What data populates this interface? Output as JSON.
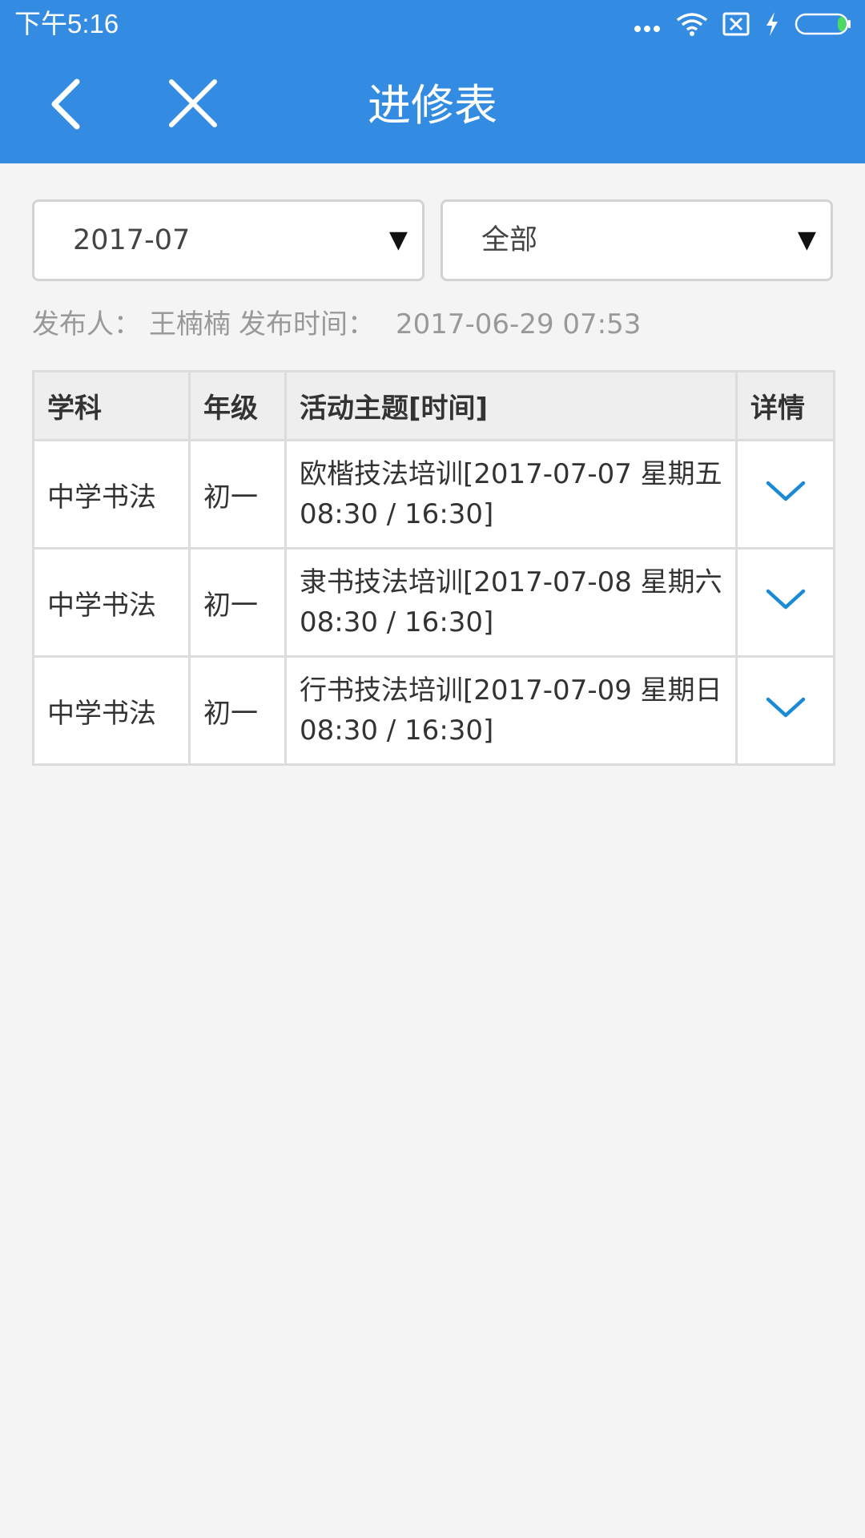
{
  "status_bar": {
    "time": "下午5:16",
    "icons": [
      "more-dots-icon",
      "wifi-icon",
      "sim-error-icon",
      "charging-icon",
      "battery-icon"
    ]
  },
  "header": {
    "title": "进修表",
    "back_icon": "chevron-left-icon",
    "close_icon": "close-icon",
    "background_color": "#348ce2"
  },
  "filters": {
    "month": {
      "value": "2017-07",
      "arrow": "▼"
    },
    "category": {
      "value": "全部",
      "arrow": "▼"
    }
  },
  "publish_info": {
    "publisher_label": "发布人：",
    "publisher": "王楠楠",
    "time_label": "发布时间：",
    "time": "2017-06-29 07:53"
  },
  "table": {
    "headers": [
      "学科",
      "年级",
      "活动主题[时间]",
      "详情"
    ],
    "rows": [
      {
        "subject": "中学书法",
        "grade": "初一",
        "topic_line1": "欧楷技法培训[2017-07-07 星期五",
        "topic_line2": "08:30 / 16:30]",
        "detail_icon": "chevron-down-icon"
      },
      {
        "subject": "中学书法",
        "grade": "初一",
        "topic_line1": "隶书技法培训[2017-07-08 星期六",
        "topic_line2": "08:30 / 16:30]",
        "detail_icon": "chevron-down-icon"
      },
      {
        "subject": "中学书法",
        "grade": "初一",
        "topic_line1": "行书技法培训[2017-07-09 星期日",
        "topic_line2": "08:30 / 16:30]",
        "detail_icon": "chevron-down-icon"
      }
    ],
    "accent_color": "#1a8ad4"
  }
}
